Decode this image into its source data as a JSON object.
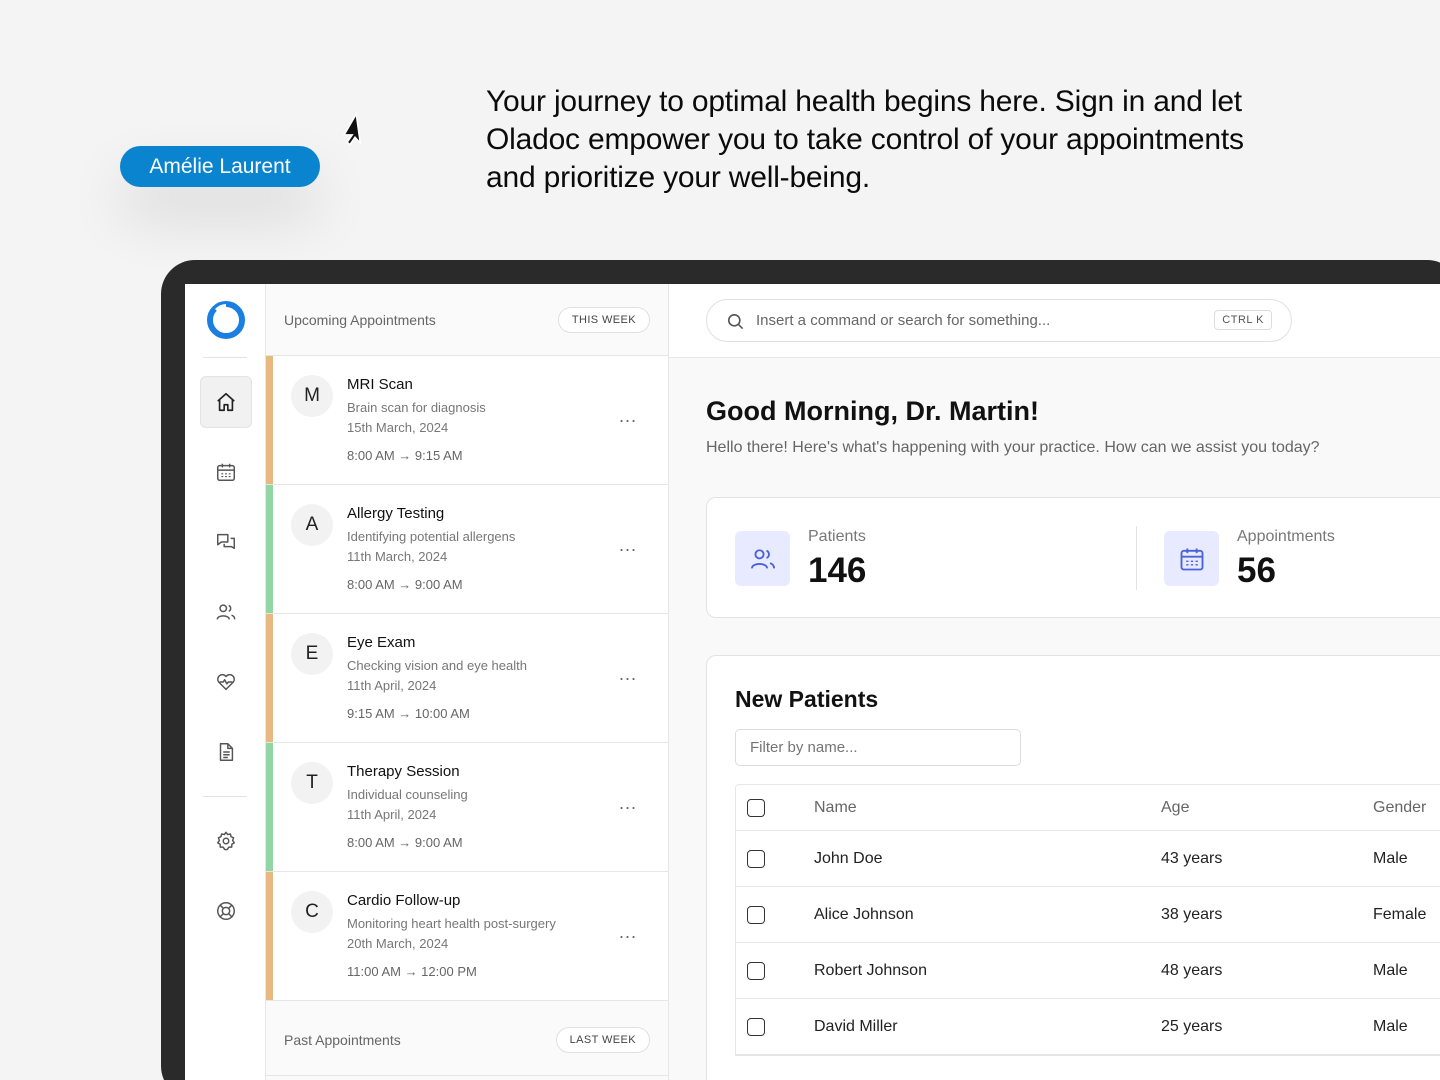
{
  "badge": {
    "name": "Amélie Laurent"
  },
  "hero": {
    "text": "Your journey to optimal health begins here. Sign in and let Oladoc empower you to take control of your appointments and prioritize your well-being."
  },
  "rail": {
    "items": [
      {
        "icon": "home-icon",
        "active": true
      },
      {
        "icon": "calendar-icon"
      },
      {
        "icon": "chat-icon"
      },
      {
        "icon": "users-icon"
      },
      {
        "icon": "heart-pulse-icon"
      },
      {
        "icon": "document-icon"
      },
      {
        "icon": "gear-icon"
      },
      {
        "icon": "lifebuoy-icon"
      }
    ]
  },
  "appointments": {
    "upcoming_title": "Upcoming Appointments",
    "upcoming_filter": "THIS WEEK",
    "past_title": "Past Appointments",
    "past_filter": "LAST WEEK",
    "more_label": "...",
    "items": [
      {
        "initial": "M",
        "name": "MRI Scan",
        "desc": "Brain scan for diagnosis",
        "date": "15th March, 2024",
        "time": "8:00 AM → 9:15 AM",
        "color": "#e8b882"
      },
      {
        "initial": "A",
        "name": "Allergy Testing",
        "desc": "Identifying potential allergens",
        "date": "11th March, 2024",
        "time": "8:00 AM → 9:00 AM",
        "color": "#93d6a4"
      },
      {
        "initial": "E",
        "name": "Eye Exam",
        "desc": "Checking vision and eye health",
        "date": "11th April, 2024",
        "time": "9:15 AM → 10:00 AM",
        "color": "#e8b882"
      },
      {
        "initial": "T",
        "name": "Therapy Session",
        "desc": "Individual counseling",
        "date": "11th April, 2024",
        "time": "8:00 AM → 9:00 AM",
        "color": "#93d6a4"
      },
      {
        "initial": "C",
        "name": "Cardio Follow-up",
        "desc": "Monitoring heart health post-surgery",
        "date": "20th March, 2024",
        "time": "11:00 AM → 12:00 PM",
        "color": "#e8b882"
      }
    ]
  },
  "search": {
    "placeholder": "Insert a command or search for something...",
    "shortcut": "CTRL K"
  },
  "main": {
    "greeting": "Good Morning, Dr. Martin!",
    "subtitle": "Hello there! Here's what's happening with your practice. How can we assist you today?"
  },
  "stats": {
    "patients": {
      "label": "Patients",
      "value": "146"
    },
    "appointments": {
      "label": "Appointments",
      "value": "56"
    }
  },
  "new_patients": {
    "title": "New Patients",
    "filter_placeholder": "Filter by name...",
    "columns": {
      "name": "Name",
      "age": "Age",
      "gender": "Gender"
    },
    "rows": [
      {
        "name": "John Doe",
        "age": "43 years",
        "gender": "Male"
      },
      {
        "name": "Alice Johnson",
        "age": "38 years",
        "gender": "Female"
      },
      {
        "name": "Robert Johnson",
        "age": "48 years",
        "gender": "Male"
      },
      {
        "name": "David Miller",
        "age": "25 years",
        "gender": "Male"
      }
    ]
  },
  "colors": {
    "accent": "#0a84cf",
    "stat_icon_bg": "#e8eaff",
    "stat_icon_fg": "#4a63d8"
  }
}
